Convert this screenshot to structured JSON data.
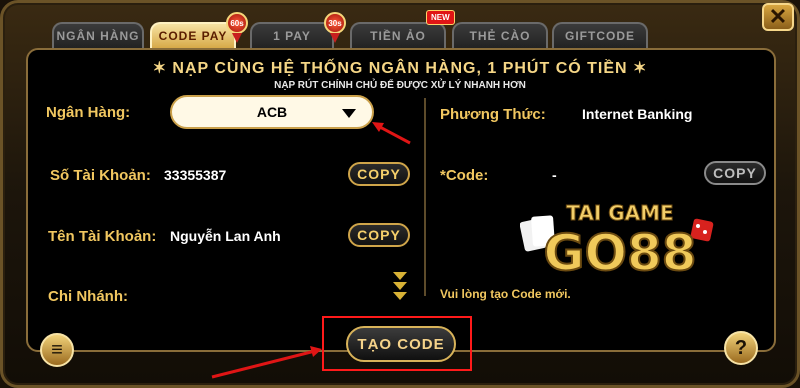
{
  "tabs": [
    {
      "label": "NGÂN HÀNG"
    },
    {
      "label": "CODE PAY",
      "badge": "60s"
    },
    {
      "label": "1 PAY",
      "badge": "30s"
    },
    {
      "label": "TIỀN ẢO",
      "badge": "NEW"
    },
    {
      "label": "THẺ CÀO"
    },
    {
      "label": "GIFTCODE"
    }
  ],
  "header": {
    "title": "✶ NẠP CÙNG HỆ THỐNG NGÂN HÀNG, 1 PHÚT CÓ TIỀN ✶",
    "subtitle": "NẠP RÚT CHÍNH CHỦ ĐỂ ĐƯỢC XỬ LÝ NHANH HƠN"
  },
  "left": {
    "bank_label": "Ngân Hàng:",
    "bank_value": "ACB",
    "account_no_label": "Số Tài Khoản:",
    "account_no_value": "33355387",
    "account_name_label": "Tên Tài Khoản:",
    "account_name_value": "Nguyễn Lan Anh",
    "branch_label": "Chi Nhánh:",
    "copy_label": "COPY"
  },
  "right": {
    "method_label": "Phương Thức:",
    "method_value": "Internet Banking",
    "code_label": "*Code:",
    "code_value": "-",
    "copy_label": "COPY",
    "note": "Vui lòng tạo Code mới."
  },
  "logo": {
    "line1": "TAI GAME",
    "line2": "GO88"
  },
  "actions": {
    "create_code": "TẠO CODE",
    "help": "?"
  },
  "icons": {
    "close": "close-icon",
    "menu": "list-icon",
    "help": "question-icon"
  },
  "colors": {
    "accent": "#f1c760",
    "active_tab": "#e8c26a",
    "highlight": "#ff1a1a"
  }
}
